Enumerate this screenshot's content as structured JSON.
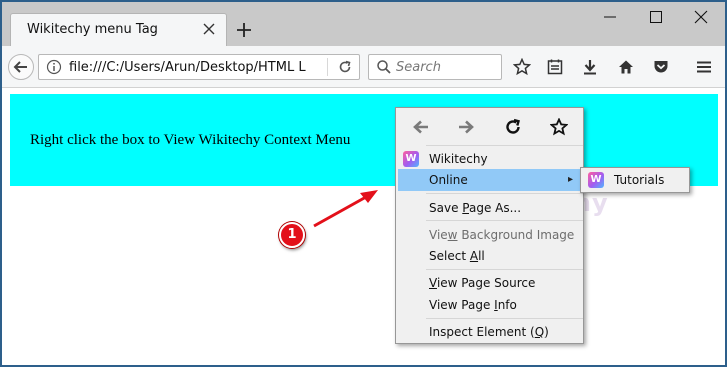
{
  "browser": {
    "tab_title": "Wikitechy menu Tag",
    "url": "file:///C:/Users/Arun/Desktop/HTML L",
    "search_placeholder": "Search"
  },
  "page": {
    "box_text": "Right click the box to View Wikitechy Context Menu",
    "box_color": "#00ffff",
    "watermark": "Wikitechy"
  },
  "annotation": {
    "marker_number": "1",
    "marker_color": "#e3101a"
  },
  "context_menu": {
    "nav_icons": [
      "back-arrow-icon",
      "forward-arrow-icon",
      "reload-icon",
      "bookmark-star-icon"
    ],
    "custom_item": "Wikitechy",
    "online_item": "Online",
    "save_pre": "Save ",
    "save_u": "P",
    "save_post": "age As...",
    "viewbg_pre": "Vie",
    "viewbg_u": "w",
    "viewbg_post": " Background Image",
    "selectall_pre": "Select ",
    "selectall_u": "A",
    "selectall_post": "ll",
    "viewsrc_pre": "",
    "viewsrc_u": "V",
    "viewsrc_post": "iew Page Source",
    "viewinfo_pre": "View Page ",
    "viewinfo_u": "I",
    "viewinfo_post": "nfo",
    "inspect_pre": "Inspect Element (",
    "inspect_u": "Q",
    "inspect_post": ")",
    "highlight_color": "#91c9f7"
  },
  "submenu": {
    "item": "Tutorials"
  }
}
